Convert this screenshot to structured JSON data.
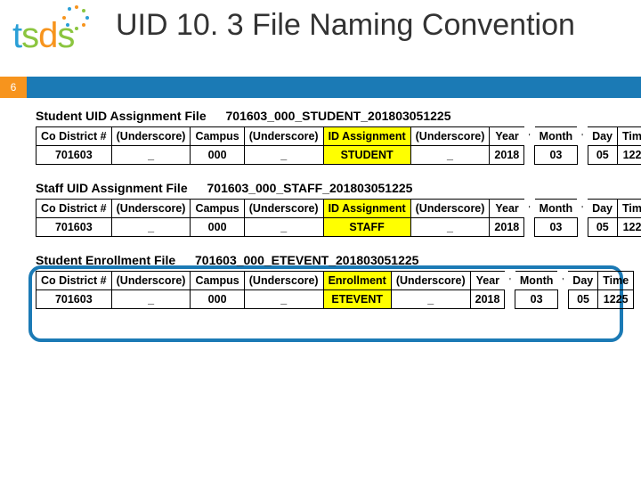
{
  "header": {
    "logo": {
      "letters": [
        "t",
        "s",
        "d",
        "s"
      ]
    },
    "title": "UID 10. 3 File Naming Convention",
    "slide_number": "6"
  },
  "columns": {
    "co_district": "Co District #",
    "underscore": "(Underscore)",
    "campus": "Campus",
    "id_assignment": "ID Assignment",
    "enrollment": "Enrollment",
    "year": "Year",
    "month": "Month",
    "day": "Day",
    "time": "Time"
  },
  "common_values": {
    "co_district": "701603",
    "underscore": "_",
    "campus": "000",
    "year": "2018",
    "month": "03",
    "day": "05",
    "time": "1225",
    "apostrophe": "'"
  },
  "sections": [
    {
      "title": "Student UID Assignment File",
      "filename": "701603_000_STUDENT_201803051225",
      "label_col5": "id_assignment",
      "value_col5": "STUDENT"
    },
    {
      "title": "Staff UID Assignment File",
      "filename": "701603_000_STAFF_201803051225",
      "label_col5": "id_assignment",
      "value_col5": "STAFF"
    },
    {
      "title": "Student Enrollment File",
      "filename": "701603_000_ETEVENT_201803051225",
      "label_col5": "enrollment",
      "value_col5": "ETEVENT"
    }
  ]
}
